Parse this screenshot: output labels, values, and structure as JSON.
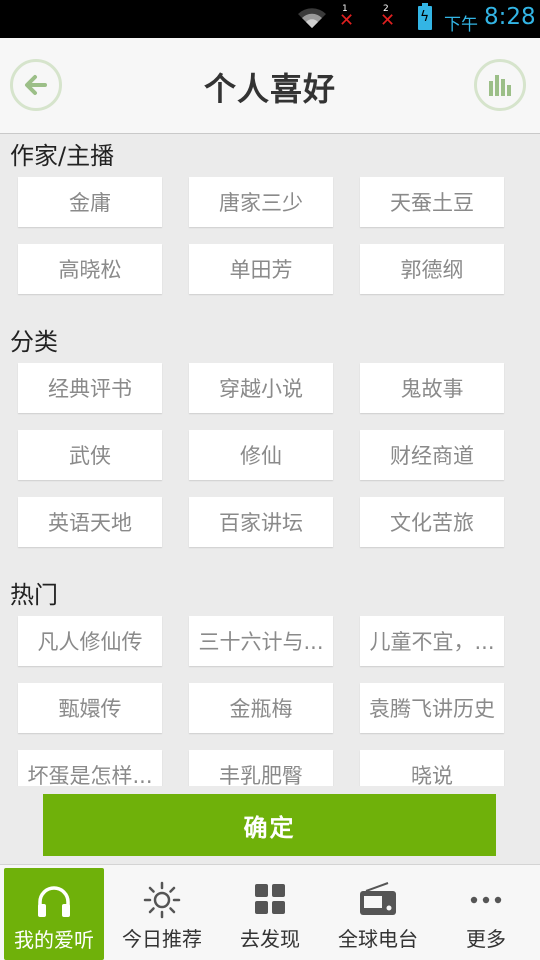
{
  "status_bar": {
    "sim1": "1",
    "sim2": "2",
    "ampm": "下午",
    "time": "8:28",
    "accent_color": "#33b5e5"
  },
  "header": {
    "title": "个人喜好",
    "back_icon": "arrow-left-icon",
    "stats_icon": "bar-chart-icon",
    "border_color": "#d6e4cc"
  },
  "sections": {
    "authors": {
      "title": "作家/主播",
      "tags": [
        "金庸",
        "唐家三少",
        "天蚕土豆",
        "高晓松",
        "单田芳",
        "郭德纲"
      ]
    },
    "categories": {
      "title": "分类",
      "tags": [
        "经典评书",
        "穿越小说",
        "鬼故事",
        "武侠",
        "修仙",
        "财经商道",
        "英语天地",
        "百家讲坛",
        "文化苦旅"
      ]
    },
    "hot": {
      "title": "热门",
      "tags": [
        "凡人修仙传",
        "三十六计与...",
        "儿童不宜，...",
        "甄嬛传",
        "金瓶梅",
        "袁腾飞讲历史",
        "坏蛋是怎样...",
        "丰乳肥臀",
        "晓说"
      ]
    }
  },
  "confirm_label": "确定",
  "accent_color": "#6fb10a",
  "bottom_nav": [
    {
      "label": "我的爱听",
      "icon": "headphones-icon",
      "active": true
    },
    {
      "label": "今日推荐",
      "icon": "sun-icon",
      "active": false
    },
    {
      "label": "去发现",
      "icon": "grid-icon",
      "active": false
    },
    {
      "label": "全球电台",
      "icon": "radio-icon",
      "active": false
    },
    {
      "label": "更多",
      "icon": "more-icon",
      "active": false
    }
  ]
}
